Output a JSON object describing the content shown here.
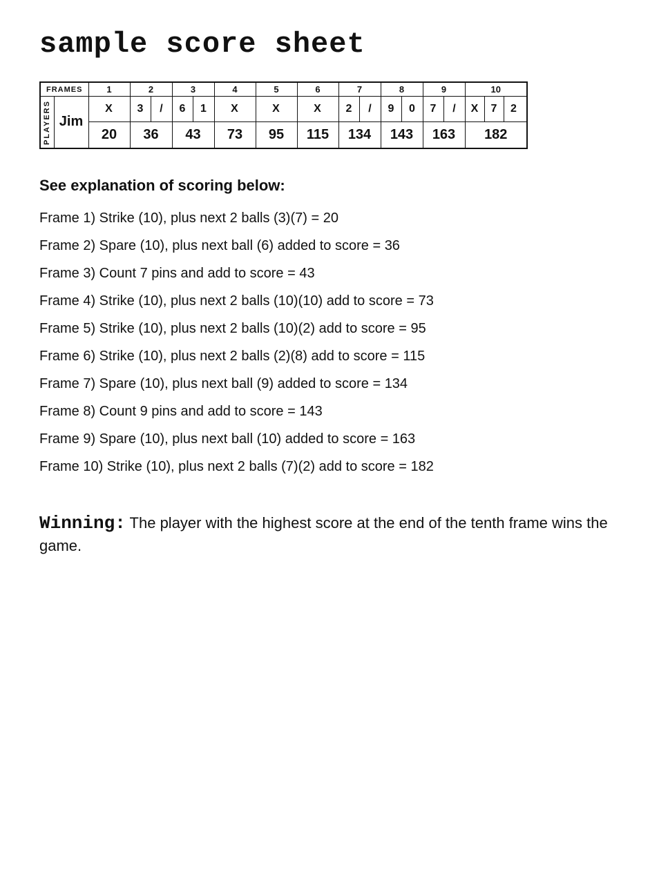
{
  "title": "sample score sheet",
  "table": {
    "frames_label": "FRAMES",
    "players_label": "PLAYERS",
    "frame_numbers": [
      "1",
      "2",
      "3",
      "4",
      "5",
      "6",
      "7",
      "8",
      "9",
      "10"
    ],
    "player_name": "Jim",
    "frames": [
      {
        "balls": [
          "X"
        ],
        "score": "20"
      },
      {
        "balls": [
          "3",
          "/"
        ],
        "score": "36"
      },
      {
        "balls": [
          "6",
          "1"
        ],
        "score": "43"
      },
      {
        "balls": [
          "X"
        ],
        "score": "73"
      },
      {
        "balls": [
          "X"
        ],
        "score": "95"
      },
      {
        "balls": [
          "X"
        ],
        "score": "115"
      },
      {
        "balls": [
          "2",
          "/"
        ],
        "score": "134"
      },
      {
        "balls": [
          "9",
          "0"
        ],
        "score": "143"
      },
      {
        "balls": [
          "7",
          "/"
        ],
        "score": "163"
      },
      {
        "balls": [
          "X",
          "7",
          "2"
        ],
        "score": "182"
      }
    ]
  },
  "explanation": {
    "heading": "See explanation of scoring below:",
    "frames": [
      "Frame 1) Strike (10), plus next 2 balls (3)(7) = 20",
      "Frame 2) Spare (10), plus next ball (6) added to score = 36",
      "Frame 3) Count 7 pins and add to score = 43",
      "Frame 4) Strike (10), plus next 2 balls (10)(10) add to score = 73",
      "Frame 5) Strike (10), plus next 2 balls (10)(2) add to score = 95",
      "Frame 6) Strike (10), plus next 2 balls (2)(8) add to score = 115",
      "Frame 7) Spare (10), plus next ball (9) added to score = 134",
      "Frame 8) Count 9 pins and add to score = 143",
      "Frame 9) Spare (10), plus next ball (10) added to score = 163",
      "Frame 10) Strike (10), plus next 2 balls (7)(2) add to score = 182"
    ]
  },
  "winning": {
    "label": "Winning:",
    "text": " The player with the highest score at the end of the tenth frame wins the game."
  }
}
